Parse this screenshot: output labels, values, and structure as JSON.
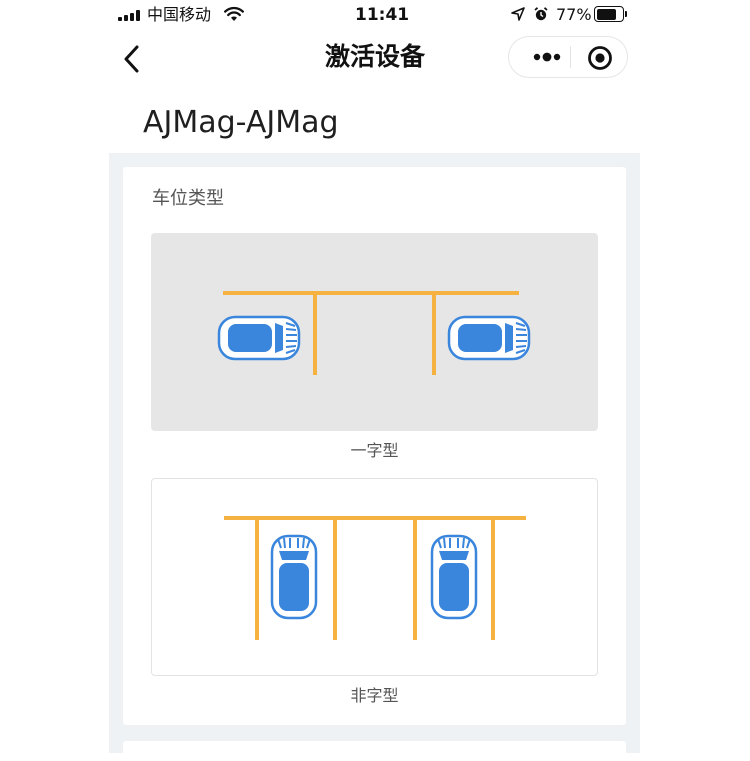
{
  "status_bar": {
    "carrier": "中国移动",
    "time": "11:41",
    "battery_percent": "77%",
    "battery_level": 0.77
  },
  "nav": {
    "title": "激活设备",
    "icons": [
      "back-arrow-icon",
      "more-dots-icon",
      "target-circle-icon"
    ]
  },
  "device": {
    "name": "AJMag-AJMag"
  },
  "parking": {
    "section_title": "车位类型",
    "options": [
      {
        "label": "一字型",
        "selected": true
      },
      {
        "label": "非字型",
        "selected": false
      }
    ]
  },
  "colors": {
    "line": "#f5b240",
    "car": "#3b86dd",
    "selected_bg": "#e6e6e6",
    "page_bg": "#eef2f5"
  }
}
